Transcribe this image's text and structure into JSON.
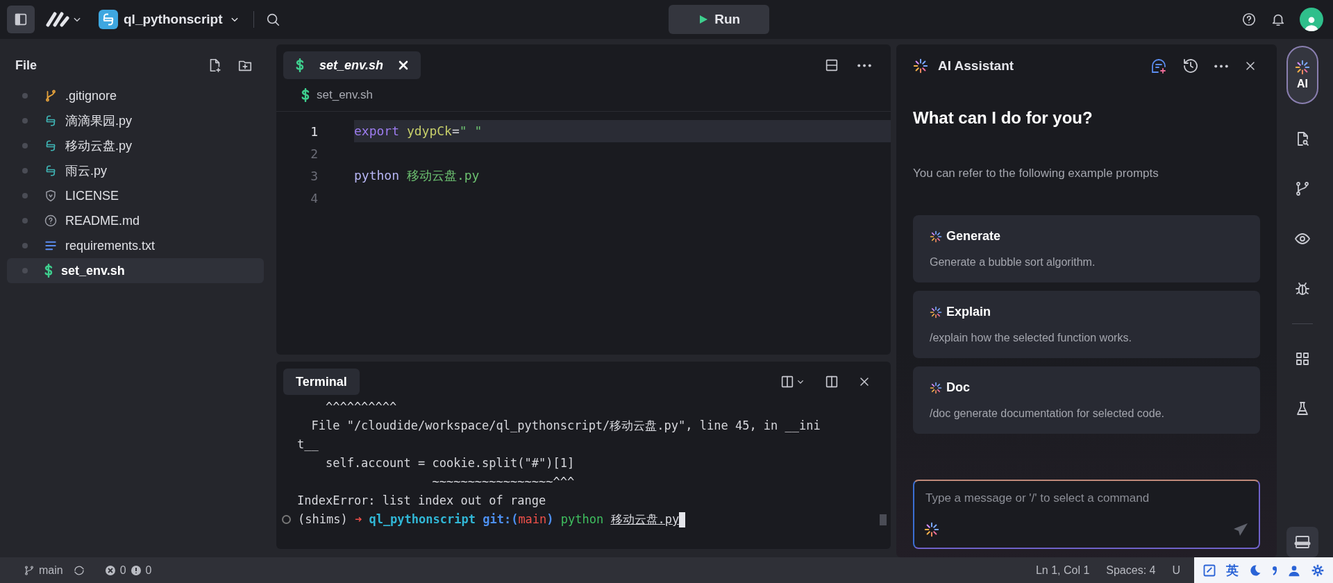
{
  "topbar": {
    "project": "ql_pythonscript",
    "run_label": "Run"
  },
  "sidebar": {
    "title": "File",
    "files": [
      {
        "name": ".gitignore",
        "kind": "git",
        "selected": false
      },
      {
        "name": "滴滴果园.py",
        "kind": "python",
        "selected": false
      },
      {
        "name": "移动云盘.py",
        "kind": "python",
        "selected": false
      },
      {
        "name": "雨云.py",
        "kind": "python",
        "selected": false
      },
      {
        "name": "LICENSE",
        "kind": "license",
        "selected": false
      },
      {
        "name": "README.md",
        "kind": "readme",
        "selected": false
      },
      {
        "name": "requirements.txt",
        "kind": "text",
        "selected": false
      },
      {
        "name": "set_env.sh",
        "kind": "shell",
        "selected": true
      }
    ]
  },
  "editor": {
    "tabs": [
      {
        "label": "set_env.sh",
        "selected": true
      }
    ],
    "breadcrumb": "set_env.sh",
    "lines": [
      {
        "number": "1",
        "current": true,
        "tokens": [
          {
            "text": "export",
            "kind": "keyword"
          },
          {
            "text": "ydypCk",
            "kind": "variable"
          },
          {
            "text": "=",
            "kind": "plain"
          },
          {
            "text": "\" \"",
            "kind": "string"
          }
        ]
      },
      {
        "number": "2",
        "current": false
      },
      {
        "number": "3",
        "current": false,
        "tokens": [
          {
            "text": "python",
            "kind": "command"
          },
          {
            "text": "移动云盘.py",
            "kind": "string"
          }
        ]
      },
      {
        "number": "4",
        "current": false
      }
    ]
  },
  "terminal": {
    "tab": "Terminal",
    "lines": [
      "    ^^^^^^^^^^",
      "  File \"/cloudide/workspace/ql_pythonscript/移动云盘.py\", line 45, in __ini",
      "t__",
      "    self.account = cookie.split(\"#\")[1]",
      "                   ~~~~~~~~~~~~~~~~~^^^",
      "IndexError: list index out of range"
    ],
    "prompt": [
      {
        "text": "(shims)",
        "kind": "plain"
      },
      {
        "text": "➜",
        "kind": "arrow"
      },
      {
        "text": "ql_pythonscript",
        "kind": "dir"
      },
      {
        "text": "git:(",
        "kind": "git"
      },
      {
        "text": "main",
        "kind": "branch"
      },
      {
        "text": ")",
        "kind": "git"
      },
      {
        "text": "python",
        "kind": "cmd"
      },
      {
        "text": "移动云盘.py",
        "kind": "arg"
      }
    ]
  },
  "ai": {
    "title": "AI Assistant",
    "heading": "What can I do for you?",
    "hint": "You can refer to the following example prompts",
    "prompts": [
      {
        "title": "Generate",
        "description": "Generate a bubble sort algorithm."
      },
      {
        "title": "Explain",
        "description": "/explain how the selected function works."
      },
      {
        "title": "Doc",
        "description": "/doc generate documentation for selected code."
      }
    ],
    "input": {
      "placeholder": "Type a message or '/' to select a command"
    }
  },
  "rail": [
    {
      "kind": "ai",
      "label": "AI",
      "selected": true
    },
    {
      "kind": "file-search",
      "selected": false
    },
    {
      "kind": "branch",
      "selected": false
    },
    {
      "kind": "eye",
      "selected": false
    },
    {
      "kind": "bug",
      "selected": false
    },
    {
      "kind": "grid",
      "selected": false
    },
    {
      "kind": "flask",
      "selected": false
    },
    {
      "kind": "panel",
      "selected": true
    }
  ],
  "status_bar": {
    "branch": "main",
    "errors": "0",
    "warnings": "0",
    "position": "Ln 1, Col 1",
    "spaces": "Spaces: 4",
    "encoding": "U"
  },
  "ime": {
    "label": "英"
  }
}
